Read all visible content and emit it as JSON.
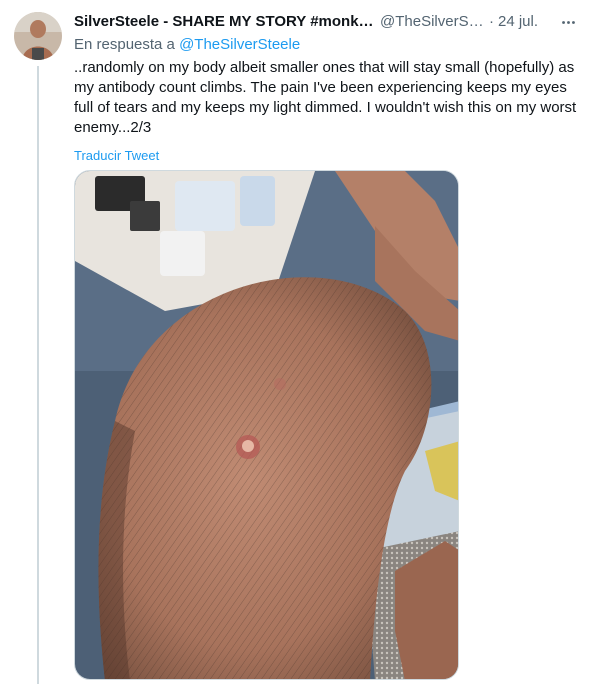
{
  "tweet": {
    "author_name": "SilverSteele - SHARE MY STORY #monke...",
    "author_handle": "@TheSilverSt...",
    "separator": "·",
    "timestamp": "24 jul.",
    "more_icon": "more-horizontal-icon",
    "reply_prefix": "En respuesta a",
    "reply_handle": "@TheSilverSteele",
    "text": "..randomly on my body albeit smaller ones that will stay small (hopefully) as my antibody count climbs. The pain I've been experiencing keeps my eyes full of tears and my keeps my light dimmed. I wouldn't wish this on my worst enemy...2/3",
    "translate_label": "Traducir Tweet"
  },
  "colors": {
    "text_primary": "#0f1419",
    "text_secondary": "#536471",
    "link": "#1d9bf0",
    "thread_line": "#cfd9de"
  }
}
